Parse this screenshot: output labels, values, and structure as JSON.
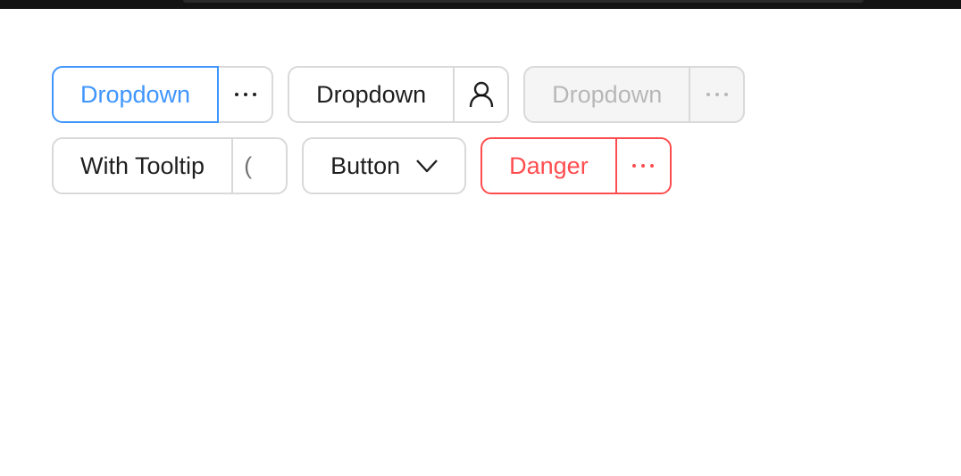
{
  "buttons": {
    "primary_dropdown": {
      "label": "Dropdown",
      "menu_icon": "ellipsis-icon"
    },
    "user_dropdown": {
      "label": "Dropdown",
      "menu_icon": "user-icon"
    },
    "disabled_dropdown": {
      "label": "Dropdown",
      "menu_icon": "ellipsis-icon"
    },
    "tooltip_dropdown": {
      "label": "With Tooltip",
      "menu_glyph": "("
    },
    "button_dropdown": {
      "label": "Button",
      "icon": "chevron-down-icon"
    },
    "danger_dropdown": {
      "label": "Danger",
      "menu_icon": "ellipsis-icon"
    }
  },
  "colors": {
    "primary": "#4096ff",
    "danger": "#ff4d4f",
    "border": "#d9d9d9",
    "disabled_bg": "#f5f5f5",
    "top_bar": "#141414"
  }
}
